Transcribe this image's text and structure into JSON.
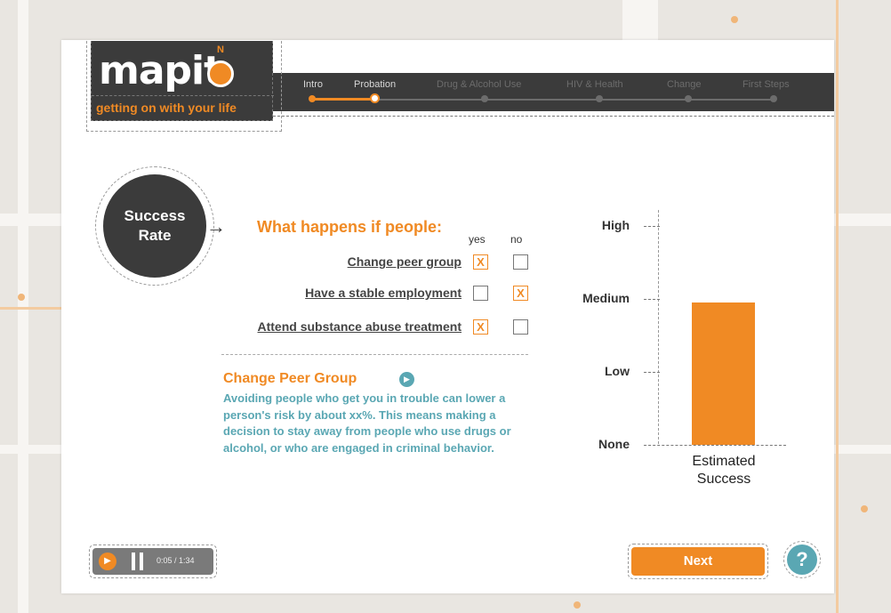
{
  "app": {
    "logo_text": "mapit",
    "logo_compass_mark": "N",
    "tagline": "getting on with your life"
  },
  "nav": {
    "steps": [
      {
        "label": "Intro",
        "state": "done"
      },
      {
        "label": "Probation",
        "state": "current"
      },
      {
        "label": "Drug & Alcohol Use",
        "state": "upcoming"
      },
      {
        "label": "HIV & Health",
        "state": "upcoming"
      },
      {
        "label": "Change",
        "state": "upcoming"
      },
      {
        "label": "First Steps",
        "state": "upcoming"
      }
    ]
  },
  "badge": {
    "line1": "Success",
    "line2": "Rate",
    "arrow": "→"
  },
  "question": {
    "title": "What happens if people:",
    "col_yes": "yes",
    "col_no": "no",
    "options": [
      {
        "label": "Change peer group",
        "yes": true,
        "no": false
      },
      {
        "label": "Have a stable employment",
        "yes": false,
        "no": true
      },
      {
        "label": "Attend substance abuse treatment",
        "yes": true,
        "no": false
      }
    ],
    "check_mark": "X"
  },
  "info": {
    "title": "Change Peer Group",
    "sound_icon": "speaker-icon",
    "body": "Avoiding people who get you in trouble can lower a person's risk by about xx%.  This means making a decision to stay away from people who use drugs or alcohol, or who are engaged in criminal behavior."
  },
  "chart_data": {
    "type": "bar",
    "categories": [
      "Estimated Success"
    ],
    "values": [
      1.95
    ],
    "y_tick_labels": [
      "None",
      "Low",
      "Medium",
      "High"
    ],
    "ylim": [
      0,
      3
    ],
    "color": "#f08a24"
  },
  "player": {
    "time": "0:05 / 1:34",
    "volume_icon": "speaker-icon",
    "pause_icon": "pause-icon"
  },
  "buttons": {
    "next": "Next",
    "help": "?"
  },
  "colors": {
    "accent": "#f08a24",
    "dark": "#3b3b3b",
    "teal": "#5aa7b3"
  }
}
